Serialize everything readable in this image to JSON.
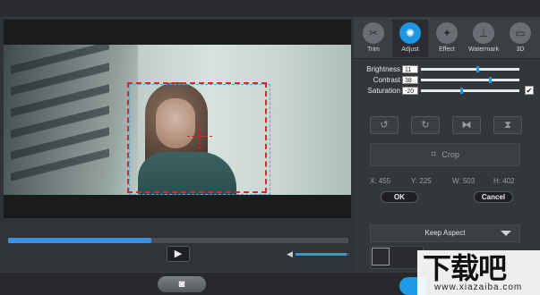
{
  "tabs": [
    {
      "label": "Trim",
      "icon": "scissors-icon",
      "glyph": "✂",
      "active": false
    },
    {
      "label": "Adjust",
      "icon": "brightness-icon",
      "glyph": "✺",
      "active": true
    },
    {
      "label": "Effect",
      "icon": "magic-wand-icon",
      "glyph": "✦",
      "active": false
    },
    {
      "label": "Watermark",
      "icon": "watermark-icon",
      "glyph": "⊥",
      "active": false
    },
    {
      "label": "3D",
      "icon": "3d-glasses-icon",
      "glyph": "▭",
      "active": false
    }
  ],
  "adjust": {
    "brightness": {
      "label": "Brightness",
      "value": "11",
      "level": 0.56
    },
    "contrast": {
      "label": "Contrast",
      "value": "38",
      "level": 0.69
    },
    "saturation": {
      "label": "Saturation",
      "value": "-20",
      "level": 0.4
    },
    "apply_all_checked": true
  },
  "transform_buttons": [
    {
      "name": "rotate-left-button",
      "icon": "rotate-left-icon",
      "glyph": "↺"
    },
    {
      "name": "rotate-right-button",
      "icon": "rotate-right-icon",
      "glyph": "↻"
    },
    {
      "name": "flip-horizontal-button",
      "icon": "flip-horizontal-icon",
      "glyph": "⧓"
    },
    {
      "name": "flip-vertical-button",
      "icon": "flip-vertical-icon",
      "glyph": "⧗"
    }
  ],
  "crop": {
    "label": "Crop",
    "x": "X: 455",
    "y": "Y: 225",
    "w": "W: 503",
    "h": "H: 402",
    "ok": "OK",
    "cancel": "Cancel",
    "aspect": "Keep Aspect"
  },
  "playback": {
    "progress": 0.42,
    "volume": 0.95,
    "play_glyph": "▶"
  },
  "snapshot_glyph": "◙",
  "colors": {
    "accent": "#1e96e4",
    "crop_border": "#e32424",
    "crop_guide": "#35b6e6"
  },
  "watermark": {
    "text": "下载吧",
    "url": "www.xiazaiba.com"
  }
}
